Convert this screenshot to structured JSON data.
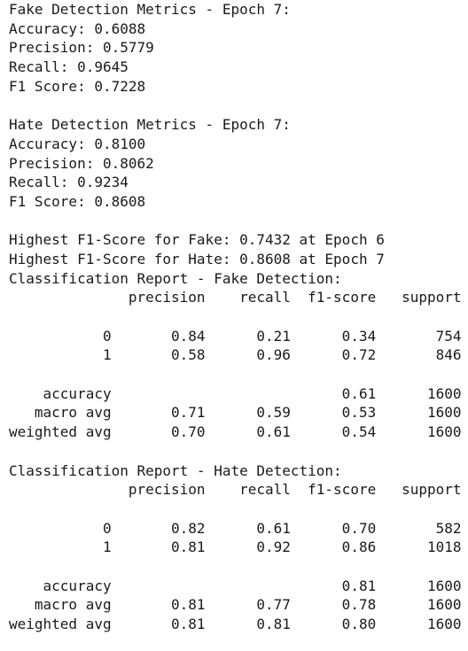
{
  "output_lines": [
    "Fake Detection Metrics - Epoch 7:",
    "Accuracy: 0.6088",
    "Precision: 0.5779",
    "Recall: 0.9645",
    "F1 Score: 0.7228",
    "",
    "Hate Detection Metrics - Epoch 7:",
    "Accuracy: 0.8100",
    "Precision: 0.8062",
    "Recall: 0.9234",
    "F1 Score: 0.8608",
    "",
    "Highest F1-Score for Fake: 0.7432 at Epoch 6",
    "Highest F1-Score for Hate: 0.8608 at Epoch 7",
    "Classification Report - Fake Detection:",
    "              precision    recall  f1-score   support",
    "",
    "           0       0.84      0.21      0.34       754",
    "           1       0.58      0.96      0.72       846",
    "",
    "    accuracy                           0.61      1600",
    "   macro avg       0.71      0.59      0.53      1600",
    "weighted avg       0.70      0.61      0.54      1600",
    "",
    "Classification Report - Hate Detection:",
    "              precision    recall  f1-score   support",
    "",
    "           0       0.82      0.61      0.70       582",
    "           1       0.81      0.92      0.86      1018",
    "",
    "    accuracy                           0.81      1600",
    "   macro avg       0.81      0.77      0.78      1600",
    "weighted avg       0.81      0.81      0.80      1600"
  ]
}
